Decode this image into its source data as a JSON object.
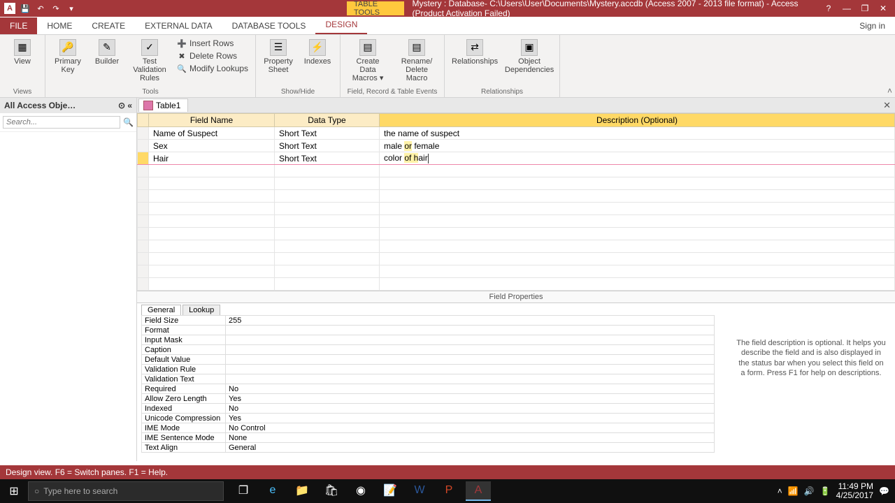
{
  "titlebar": {
    "context_tab": "TABLE TOOLS",
    "title": "Mystery : Database- C:\\Users\\User\\Documents\\Mystery.accdb (Access 2007 - 2013 file format) - Access (Product Activation Failed)"
  },
  "tabs": {
    "file": "FILE",
    "home": "HOME",
    "create": "CREATE",
    "external": "EXTERNAL DATA",
    "dbtools": "DATABASE TOOLS",
    "design": "DESIGN",
    "signin": "Sign in"
  },
  "ribbon": {
    "views": {
      "view": "View",
      "label": "Views"
    },
    "tools": {
      "primary_key": "Primary Key",
      "builder": "Builder",
      "test_rules": "Test Validation Rules",
      "insert_rows": "Insert Rows",
      "delete_rows": "Delete Rows",
      "modify_lookups": "Modify Lookups",
      "label": "Tools"
    },
    "showhide": {
      "property_sheet": "Property Sheet",
      "indexes": "Indexes",
      "label": "Show/Hide"
    },
    "events": {
      "create_macros": "Create Data Macros ▾",
      "rename_macro": "Rename/ Delete Macro",
      "label": "Field, Record & Table Events"
    },
    "relationships": {
      "relationships": "Relationships",
      "dependencies": "Object Dependencies",
      "label": "Relationships"
    }
  },
  "navpane": {
    "title": "All Access Obje…",
    "search_placeholder": "Search..."
  },
  "table": {
    "tab_name": "Table1",
    "headers": {
      "field_name": "Field Name",
      "data_type": "Data Type",
      "description": "Description (Optional)"
    },
    "rows": [
      {
        "name": "Name of Suspect",
        "type": "Short Text",
        "desc": "the name of suspect"
      },
      {
        "name": "Sex",
        "type": "Short Text",
        "desc_pre": "male ",
        "desc_hl": "or",
        "desc_post": " female"
      },
      {
        "name": "Hair",
        "type": "Short Text",
        "desc_pre": "color ",
        "desc_hl": "of h",
        "desc_post": "air"
      }
    ]
  },
  "props": {
    "header": "Field Properties",
    "tabs": {
      "general": "General",
      "lookup": "Lookup"
    },
    "rows": [
      {
        "n": "Field Size",
        "v": "255"
      },
      {
        "n": "Format",
        "v": ""
      },
      {
        "n": "Input Mask",
        "v": ""
      },
      {
        "n": "Caption",
        "v": ""
      },
      {
        "n": "Default Value",
        "v": ""
      },
      {
        "n": "Validation Rule",
        "v": ""
      },
      {
        "n": "Validation Text",
        "v": ""
      },
      {
        "n": "Required",
        "v": "No"
      },
      {
        "n": "Allow Zero Length",
        "v": "Yes"
      },
      {
        "n": "Indexed",
        "v": "No"
      },
      {
        "n": "Unicode Compression",
        "v": "Yes"
      },
      {
        "n": "IME Mode",
        "v": "No Control"
      },
      {
        "n": "IME Sentence Mode",
        "v": "None"
      },
      {
        "n": "Text Align",
        "v": "General"
      }
    ],
    "help": "The field description is optional. It helps you describe the field and is also displayed in the status bar when you select this field on a form. Press F1 for help on descriptions."
  },
  "statusbar": {
    "text": "Design view.   F6 = Switch panes.   F1 = Help."
  },
  "taskbar": {
    "search_placeholder": "Type here to search",
    "time": "11:49 PM",
    "date": "4/25/2017"
  }
}
